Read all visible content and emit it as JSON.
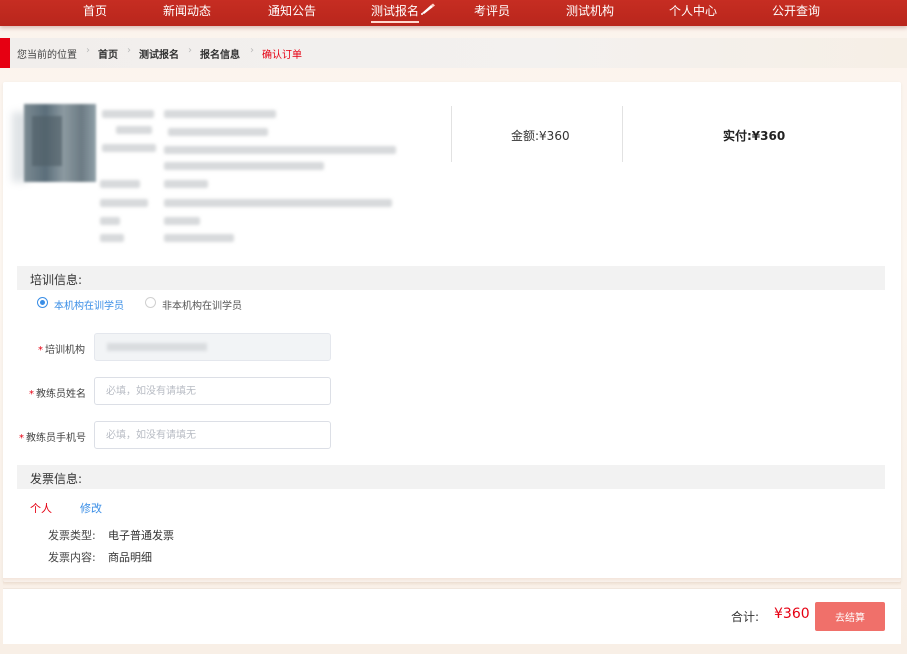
{
  "nav": {
    "items": [
      {
        "label": "首页"
      },
      {
        "label": "新闻动态"
      },
      {
        "label": "通知公告"
      },
      {
        "label": "测试报名"
      },
      {
        "label": "考评员"
      },
      {
        "label": "测试机构"
      },
      {
        "label": "个人中心"
      },
      {
        "label": "公开查询"
      }
    ],
    "active_index": 3,
    "active_icon": "pencil-icon"
  },
  "breadcrumb": {
    "prefix": "您当前的位置",
    "items": [
      "首页",
      "测试报名",
      "报名信息"
    ],
    "current": "确认订单"
  },
  "order": {
    "amount": "金额:¥360",
    "paid": "实付:¥360"
  },
  "training": {
    "title": "培训信息:",
    "options": [
      "本机构在训学员",
      "非本机构在训学员"
    ],
    "selected_index": 0,
    "fields": {
      "institution_label": "培训机构",
      "coach_name_label": "教练员姓名",
      "coach_name_placeholder": "必填，如没有请填无",
      "coach_phone_label": "教练员手机号",
      "coach_phone_placeholder": "必填，如没有请填无"
    }
  },
  "invoice": {
    "title": "发票信息:",
    "type_personal": "个人",
    "edit": "修改",
    "type_label": "发票类型:",
    "type_value": "电子普通发票",
    "content_label": "发票内容:",
    "content_value": "商品明细"
  },
  "footer": {
    "total_label": "合计:",
    "total_value": "¥360",
    "checkout": "去结算"
  },
  "colors": {
    "brand_red": "#c62d22",
    "accent_red": "#e60012",
    "link_blue": "#3a8ee6",
    "button_pink": "#f0706a"
  }
}
